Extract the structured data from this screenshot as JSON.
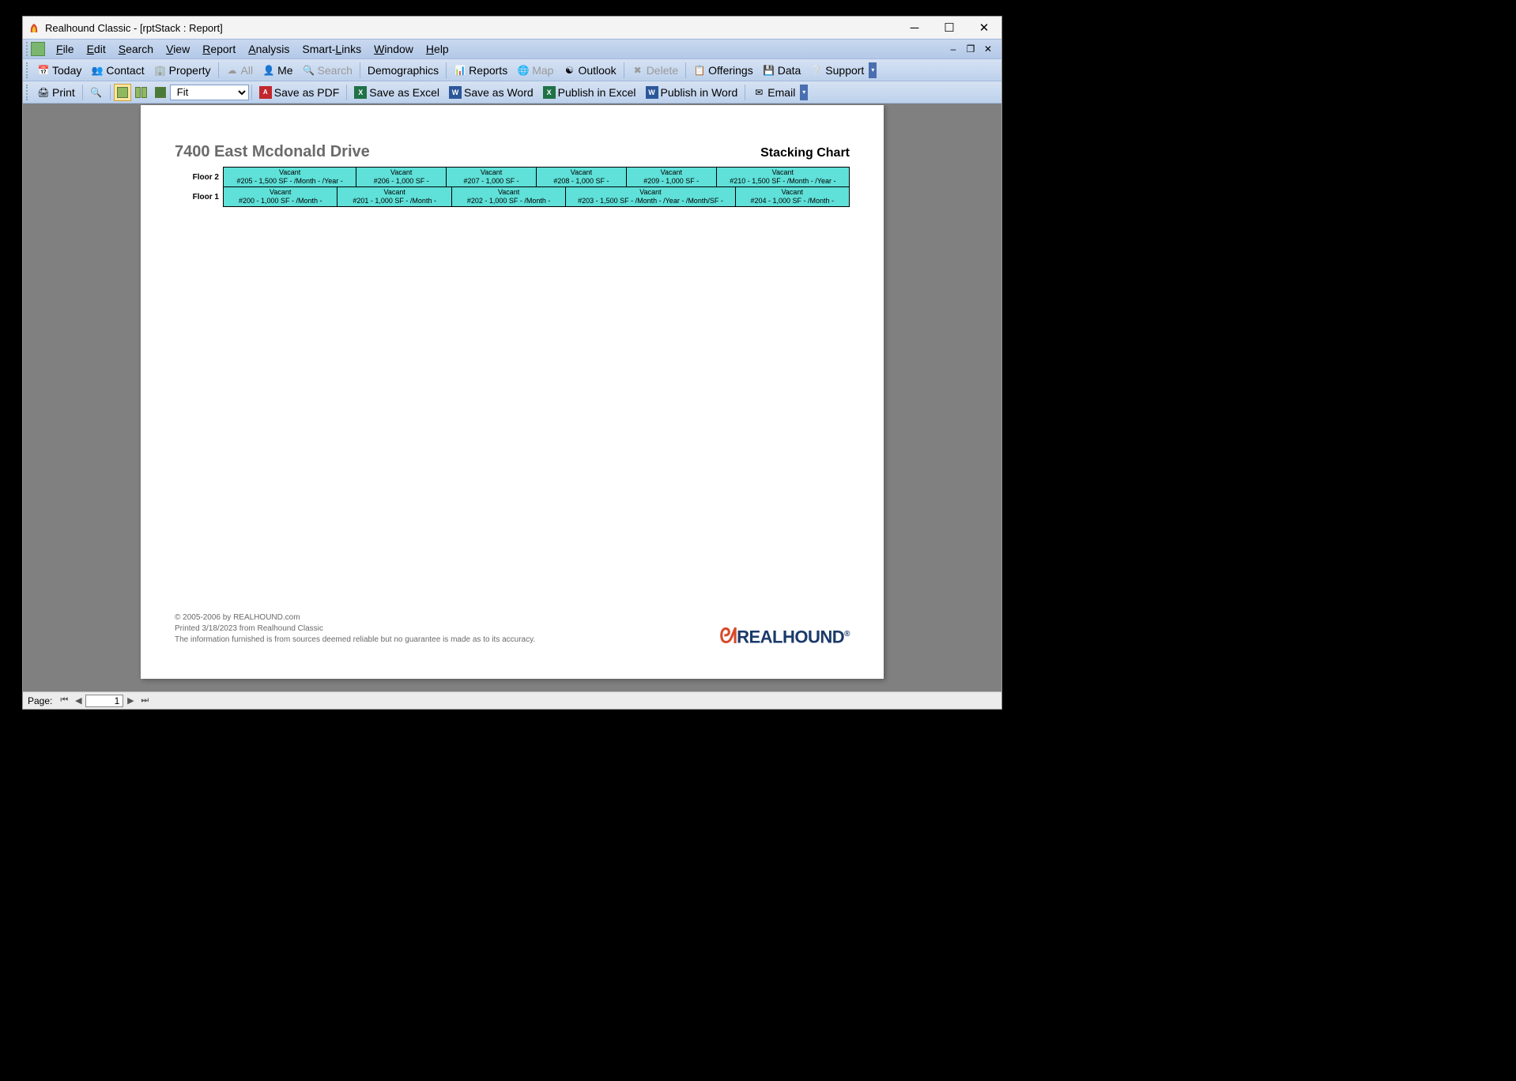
{
  "window": {
    "title": "Realhound Classic - [rptStack : Report]"
  },
  "menu": {
    "items": [
      "File",
      "Edit",
      "Search",
      "View",
      "Report",
      "Analysis",
      "Smart-Links",
      "Window",
      "Help"
    ]
  },
  "toolbar1": {
    "today": "Today",
    "contact": "Contact",
    "property": "Property",
    "all": "All",
    "me": "Me",
    "search": "Search",
    "demographics": "Demographics",
    "reports": "Reports",
    "map": "Map",
    "outlook": "Outlook",
    "delete": "Delete",
    "offerings": "Offerings",
    "data": "Data",
    "support": "Support"
  },
  "toolbar2": {
    "print": "Print",
    "zoom": "Fit",
    "save_pdf": "Save as PDF",
    "save_excel": "Save as Excel",
    "save_word": "Save as Word",
    "publish_excel": "Publish in Excel",
    "publish_word": "Publish in Word",
    "email": "Email"
  },
  "report": {
    "title": "7400 East Mcdonald Drive",
    "subtitle": "Stacking Chart",
    "floor2_label": "Floor 2",
    "floor1_label": "Floor 1",
    "floor2": [
      {
        "status": "Vacant",
        "details": "#205 - 1,500 SF - /Month - /Year -",
        "flex": 1.5
      },
      {
        "status": "Vacant",
        "details": "#206 - 1,000 SF -",
        "flex": 1.0
      },
      {
        "status": "Vacant",
        "details": "#207 - 1,000 SF -",
        "flex": 1.0
      },
      {
        "status": "Vacant",
        "details": "#208 - 1,000 SF -",
        "flex": 1.0
      },
      {
        "status": "Vacant",
        "details": "#209 - 1,000 SF -",
        "flex": 1.0
      },
      {
        "status": "Vacant",
        "details": "#210 - 1,500 SF - /Month - /Year -",
        "flex": 1.5
      }
    ],
    "floor1": [
      {
        "status": "Vacant",
        "details": "#200 - 1,000 SF - /Month -",
        "flex": 1.0
      },
      {
        "status": "Vacant",
        "details": "#201 - 1,000 SF - /Month -",
        "flex": 1.0
      },
      {
        "status": "Vacant",
        "details": "#202 - 1,000 SF - /Month -",
        "flex": 1.0
      },
      {
        "status": "Vacant",
        "details": "#203 - 1,500 SF - /Month - /Year - /Month/SF -",
        "flex": 1.5
      },
      {
        "status": "Vacant",
        "details": "#204 - 1,000 SF - /Month -",
        "flex": 1.0
      }
    ],
    "copyright": "© 2005-2006 by REALHOUND.com",
    "printed": "Printed 3/18/2023 from Realhound Classic",
    "disclaimer": "The information furnished is from sources deemed reliable but no guarantee is made as to its accuracy."
  },
  "status": {
    "page_label": "Page:",
    "page_value": "1"
  }
}
